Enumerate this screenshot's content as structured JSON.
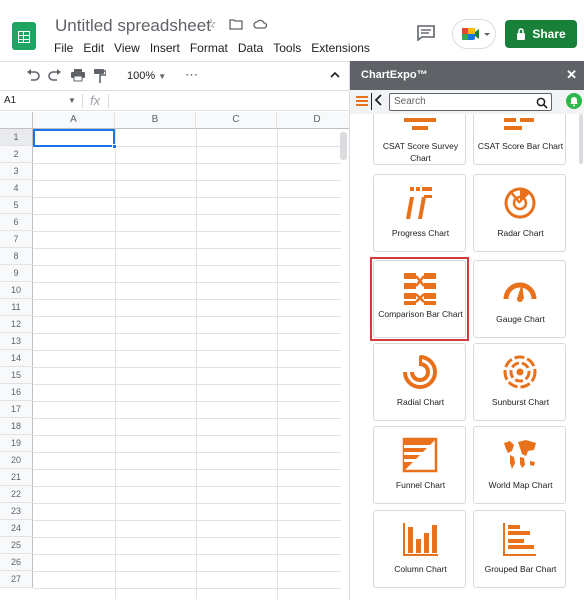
{
  "doc": {
    "title": "Untitled spreadsheet"
  },
  "menu": [
    "File",
    "Edit",
    "View",
    "Insert",
    "Format",
    "Data",
    "Tools",
    "Extensions"
  ],
  "share_label": "Share",
  "toolbar": {
    "zoom": "100%"
  },
  "formula_bar": {
    "cell_ref": "A1",
    "fx": "fx"
  },
  "grid": {
    "columns": [
      "A",
      "B",
      "C",
      "D"
    ],
    "rows": [
      "1",
      "2",
      "3",
      "4",
      "5",
      "6",
      "7",
      "8",
      "9",
      "10",
      "11",
      "12",
      "13",
      "14",
      "15",
      "16",
      "17",
      "18",
      "19",
      "20",
      "21",
      "22",
      "23",
      "24",
      "25",
      "26",
      "27"
    ]
  },
  "panel": {
    "title": "ChartExpo™",
    "search_placeholder": "Search",
    "tiles": [
      {
        "label": "CSAT Score Survey Chart",
        "icon": "csat-survey-icon"
      },
      {
        "label": "CSAT Score Bar Chart",
        "icon": "csat-bar-icon"
      },
      {
        "label": "Progress Chart",
        "icon": "progress-chart-icon"
      },
      {
        "label": "Radar Chart",
        "icon": "radar-chart-icon"
      },
      {
        "label": "Comparison Bar Chart",
        "icon": "comparison-bar-icon"
      },
      {
        "label": "Gauge Chart",
        "icon": "gauge-chart-icon"
      },
      {
        "label": "Radial Chart",
        "icon": "radial-chart-icon"
      },
      {
        "label": "Sunburst Chart",
        "icon": "sunburst-chart-icon"
      },
      {
        "label": "Funnel Chart",
        "icon": "funnel-chart-icon"
      },
      {
        "label": "World Map Chart",
        "icon": "world-map-icon"
      },
      {
        "label": "Column Chart",
        "icon": "column-chart-icon"
      },
      {
        "label": "Grouped Bar Chart",
        "icon": "grouped-bar-icon"
      }
    ]
  },
  "colors": {
    "accent": "#e8711c",
    "share": "#188038",
    "highlight": "#d13b3b",
    "selection": "#1a73e8"
  }
}
